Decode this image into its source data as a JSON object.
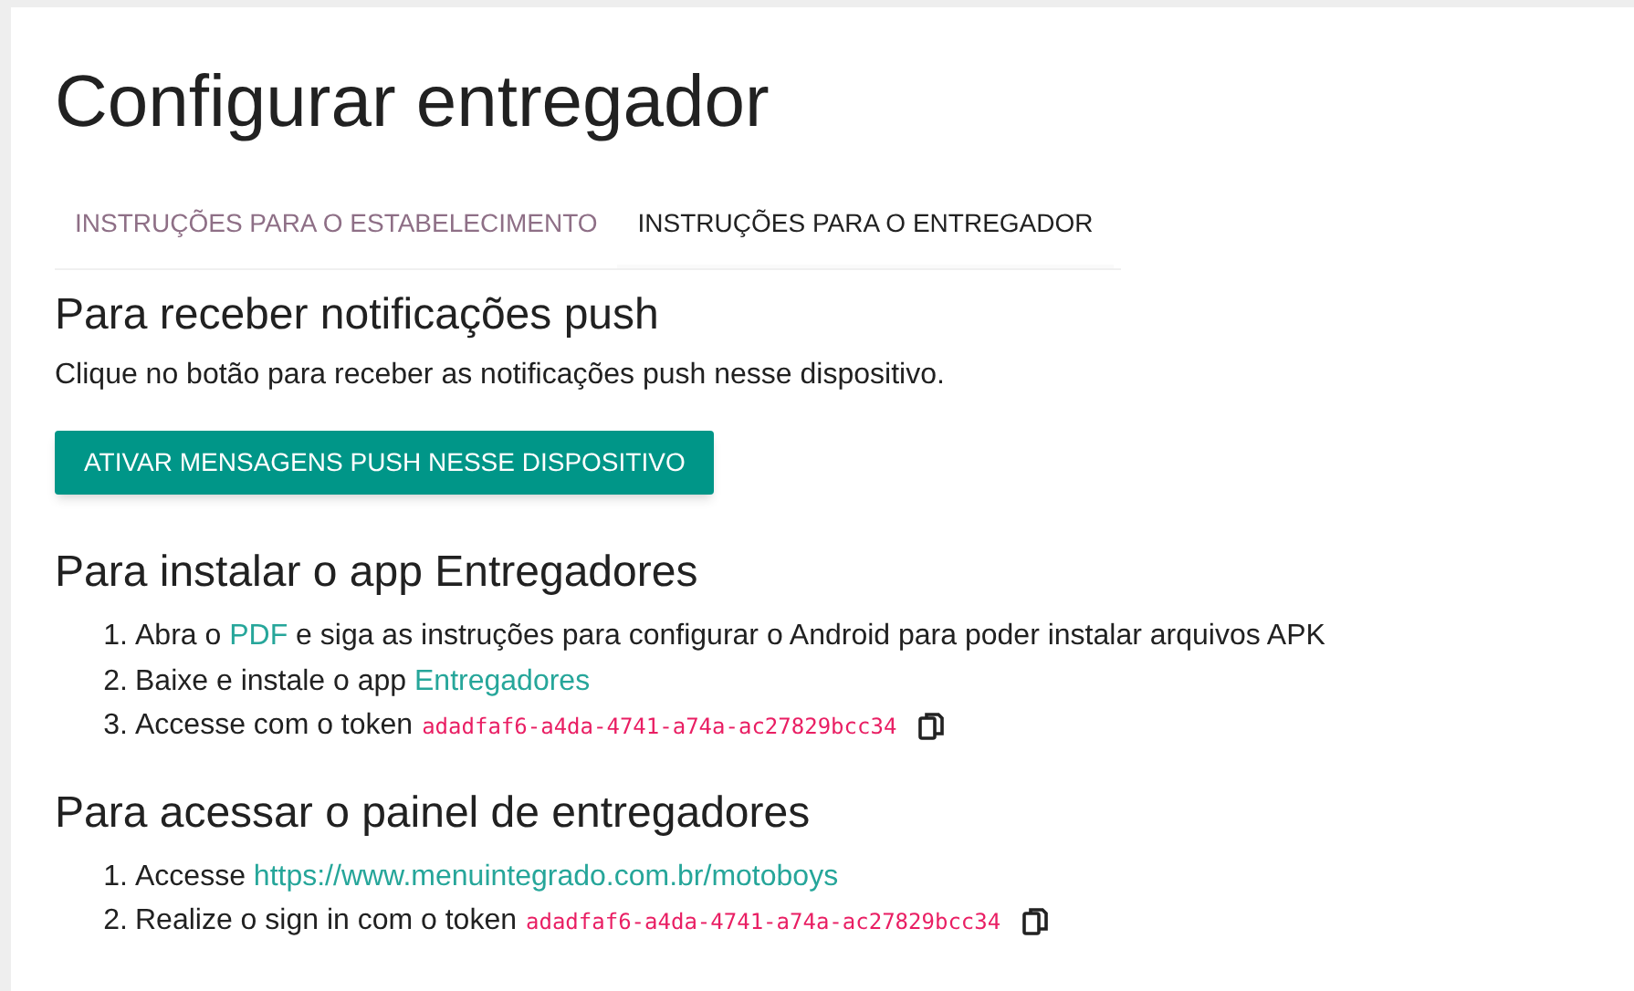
{
  "title": "Configurar entregador",
  "tabs": [
    {
      "label": "INSTRUÇÕES PARA O ESTABELECIMENTO",
      "selected": false
    },
    {
      "label": "INSTRUÇÕES PARA O ENTREGADOR",
      "selected": true
    }
  ],
  "push": {
    "heading": "Para receber notificações push",
    "text": "Clique no botão para receber as notificações push nesse dispositivo.",
    "button": "ATIVAR MENSAGENS PUSH NESSE DISPOSITIVO"
  },
  "sections": [
    {
      "heading": "Para instalar o app Entregadores",
      "items": [
        {
          "number": "1.",
          "before": "Abra o ",
          "link": "PDF",
          "after": " e siga as instruções para configurar o Android para poder instalar arquivos APK"
        },
        {
          "number": "2.",
          "before": "Baixe e instale o app ",
          "link": "Entregadores"
        },
        {
          "number": "3.",
          "before": "Accesse com o token",
          "token": "adadfaf6-a4da-4741-a74a-ac27829bcc34"
        }
      ]
    },
    {
      "heading": "Para acessar o painel de entregadores",
      "items": [
        {
          "number": "1.",
          "before": "Accesse ",
          "link": "https://www.menuintegrado.com.br/motoboys"
        },
        {
          "number": "2.",
          "before": "Realize o sign in com o token",
          "token": "adadfaf6-a4da-4741-a74a-ac27829bcc34"
        }
      ]
    }
  ]
}
